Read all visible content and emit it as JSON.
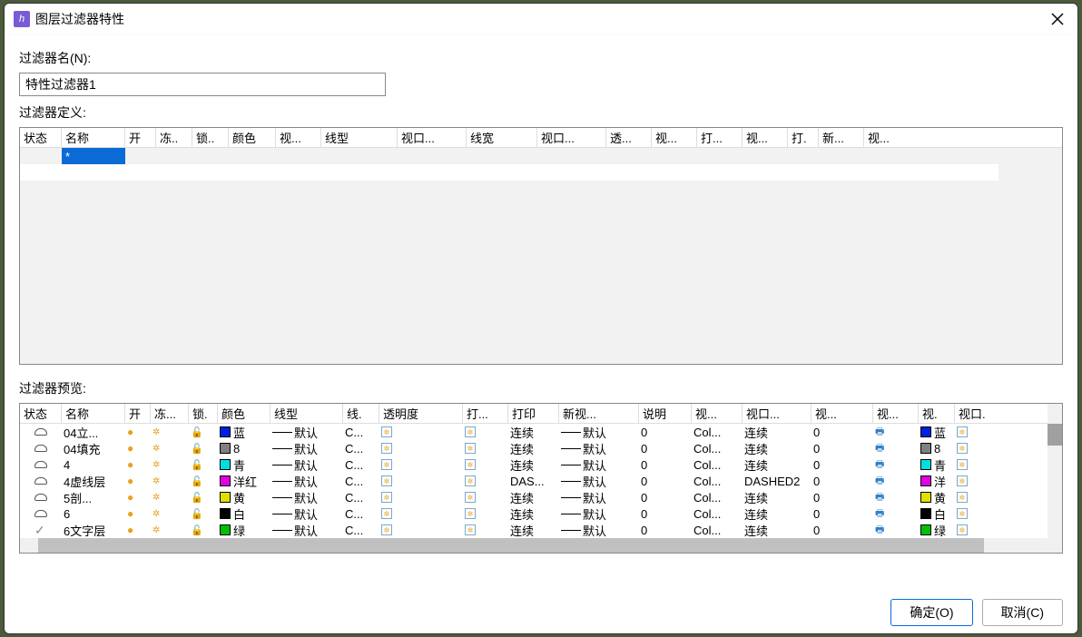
{
  "titlebar": {
    "title": "图层过滤器特性"
  },
  "filter_name_label": "过滤器名(N):",
  "filter_name_value": "特性过滤器1",
  "filter_def_label": "过滤器定义:",
  "def_headers": {
    "status": "状态",
    "name": "名称",
    "on": "开",
    "freeze": "冻..",
    "lock": "锁..",
    "color": "颜色",
    "vp": "视...",
    "linetype": "线型",
    "vp2": "视口...",
    "lineweight": "线宽",
    "vp3": "视口...",
    "trans": "透...",
    "vp4": "视...",
    "plotst": "打...",
    "vp5": "视...",
    "plot": "打.",
    "newvp": "新...",
    "vp6": "视..."
  },
  "def_rows": [
    {
      "name": "*"
    }
  ],
  "filter_preview_label": "过滤器预览:",
  "preview_headers": {
    "status": "状态",
    "name": "名称",
    "on": "开",
    "freeze": "冻...",
    "lock": "锁.",
    "color": "颜色",
    "linetype": "线型",
    "lineweight": "线.",
    "trans": "透明度",
    "plotst": "打...",
    "plot": "打印",
    "newvp": "新视...",
    "desc": "说明",
    "vp1": "视...",
    "vp2": "视口...",
    "vp3": "视...",
    "vp4": "视...",
    "vp5": "视.",
    "vp6": "视口."
  },
  "preview_rows": [
    {
      "name": "04立...",
      "color": "蓝",
      "colorhex": "#0020e0",
      "linetype": "默认",
      "lw": "C...",
      "plot": "连续",
      "nv": "默认",
      "trans": "0",
      "vp1": "Col...",
      "vp2": "连续",
      "vp3": "0",
      "vpc": "蓝",
      "vpchex": "#0020e0"
    },
    {
      "name": "04填充",
      "color": "8",
      "colorhex": "#808080",
      "linetype": "默认",
      "lw": "C...",
      "plot": "连续",
      "nv": "默认",
      "trans": "0",
      "vp1": "Col...",
      "vp2": "连续",
      "vp3": "0",
      "vpc": "8",
      "vpchex": "#808080"
    },
    {
      "name": "4",
      "color": "青",
      "colorhex": "#00e0e0",
      "linetype": "默认",
      "lw": "C...",
      "plot": "连续",
      "nv": "默认",
      "trans": "0",
      "vp1": "Col...",
      "vp2": "连续",
      "vp3": "0",
      "vpc": "青",
      "vpchex": "#00e0e0"
    },
    {
      "name": "4虚线层",
      "color": "洋红",
      "colorhex": "#e000e0",
      "linetype": "默认",
      "lw": "C...",
      "plot": "DAS...",
      "nv": "默认",
      "trans": "0",
      "vp1": "Col...",
      "vp2": "DASHED2",
      "vp3": "0",
      "vpc": "洋",
      "vpchex": "#e000e0"
    },
    {
      "name": "5剖...",
      "color": "黄",
      "colorhex": "#e0e000",
      "linetype": "默认",
      "lw": "C...",
      "plot": "连续",
      "nv": "默认",
      "trans": "0",
      "vp1": "Col...",
      "vp2": "连续",
      "vp3": "0",
      "vpc": "黄",
      "vpchex": "#e0e000"
    },
    {
      "name": "6",
      "color": "白",
      "colorhex": "#000000",
      "linetype": "默认",
      "lw": "C...",
      "plot": "连续",
      "nv": "默认",
      "trans": "0",
      "vp1": "Col...",
      "vp2": "连续",
      "vp3": "0",
      "vpc": "白",
      "vpchex": "#000000"
    },
    {
      "name": "6文字层",
      "color": "绿",
      "colorhex": "#00c000",
      "linetype": "默认",
      "lw": "C...",
      "plot": "连续",
      "nv": "默认",
      "trans": "0",
      "vp1": "Col...",
      "vp2": "连续",
      "vp3": "0",
      "vpc": "绿",
      "vpchex": "#00c000",
      "check": true
    }
  ],
  "buttons": {
    "ok": "确定(O)",
    "cancel": "取消(C)"
  }
}
